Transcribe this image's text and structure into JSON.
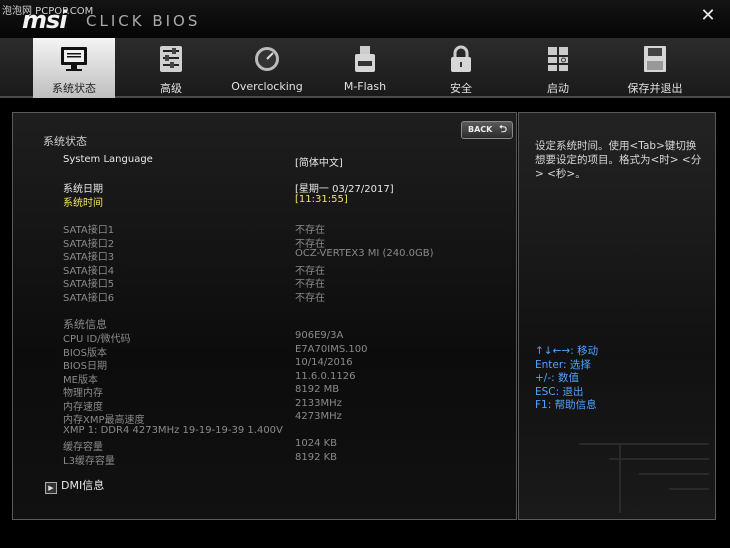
{
  "watermark": "泡泡网 PCPOP.COM",
  "brand": {
    "logo": "msi",
    "subtitle": "CLICK BIOS"
  },
  "nav": {
    "tabs": [
      {
        "label": "系统状态",
        "icon": "monitor-icon",
        "active": true
      },
      {
        "label": "高级",
        "icon": "sliders-icon"
      },
      {
        "label": "Overclocking",
        "icon": "gauge-icon"
      },
      {
        "label": "M-Flash",
        "icon": "usb-flash-icon"
      },
      {
        "label": "安全",
        "icon": "lock-icon"
      },
      {
        "label": "启动",
        "icon": "boot-icon"
      },
      {
        "label": "保存并退出",
        "icon": "save-disk-icon"
      }
    ]
  },
  "main": {
    "section_title": "系统状态",
    "back_label": "BACK",
    "system_language": {
      "label": "System Language",
      "value": "[简体中文]"
    },
    "system_date": {
      "label": "系统日期",
      "value": "[星期一 03/27/2017]"
    },
    "system_time": {
      "label": "系统时间",
      "value": "[11:31:55]"
    },
    "sata": [
      {
        "label": "SATA接口1",
        "value": "不存在"
      },
      {
        "label": "SATA接口2",
        "value": "不存在"
      },
      {
        "label": "SATA接口3",
        "value": "OCZ-VERTEX3 MI (240.0GB)"
      },
      {
        "label": "SATA接口4",
        "value": "不存在"
      },
      {
        "label": "SATA接口5",
        "value": "不存在"
      },
      {
        "label": "SATA接口6",
        "value": "不存在"
      }
    ],
    "system_info_title": "系统信息",
    "system_info": [
      {
        "label": "CPU ID/微代码",
        "value": "906E9/3A"
      },
      {
        "label": "BIOS版本",
        "value": "E7A70IMS.100"
      },
      {
        "label": "BIOS日期",
        "value": "10/14/2016"
      },
      {
        "label": "ME版本",
        "value": "11.6.0.1126"
      },
      {
        "label": "物理内存",
        "value": "8192 MB"
      },
      {
        "label": "内存速度",
        "value": "2133MHz"
      },
      {
        "label": "内存XMP最高速度",
        "value": "4273MHz"
      }
    ],
    "xmp_line": "XMP 1: DDR4 4273MHz 19-19-19-39 1.400V",
    "cache": [
      {
        "label": "缓存容量",
        "value": "1024 KB"
      },
      {
        "label": "L3缓存容量",
        "value": "8192 KB"
      }
    ],
    "dmi_label": "DMI信息"
  },
  "help": {
    "text": "设定系统时间。使用<Tab>键切换想要设定的项目。格式为<时> <分> <秒>。",
    "keys": [
      "↑↓←→: 移动",
      "Enter: 选择",
      "+/-: 数值",
      "ESC: 退出",
      "F1: 帮助信息"
    ]
  },
  "colors": {
    "highlight": "#f3e35a",
    "help_keys": "#4fa3ff"
  }
}
